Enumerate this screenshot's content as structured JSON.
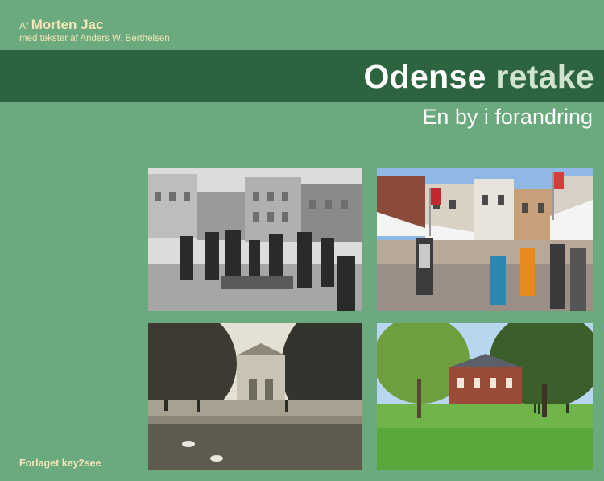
{
  "cover": {
    "author_prefix": "Af",
    "author_name": "Morten Jac",
    "co_author": "med tekster af Anders W. Berthelsen",
    "title_word1": "Odense",
    "title_word2": "retake",
    "subtitle": "En by i forandring",
    "publisher": "Forlaget key2see"
  },
  "colors": {
    "background": "#6aaa7e",
    "band": "#2d6440",
    "author_text": "#f3e6b9"
  }
}
